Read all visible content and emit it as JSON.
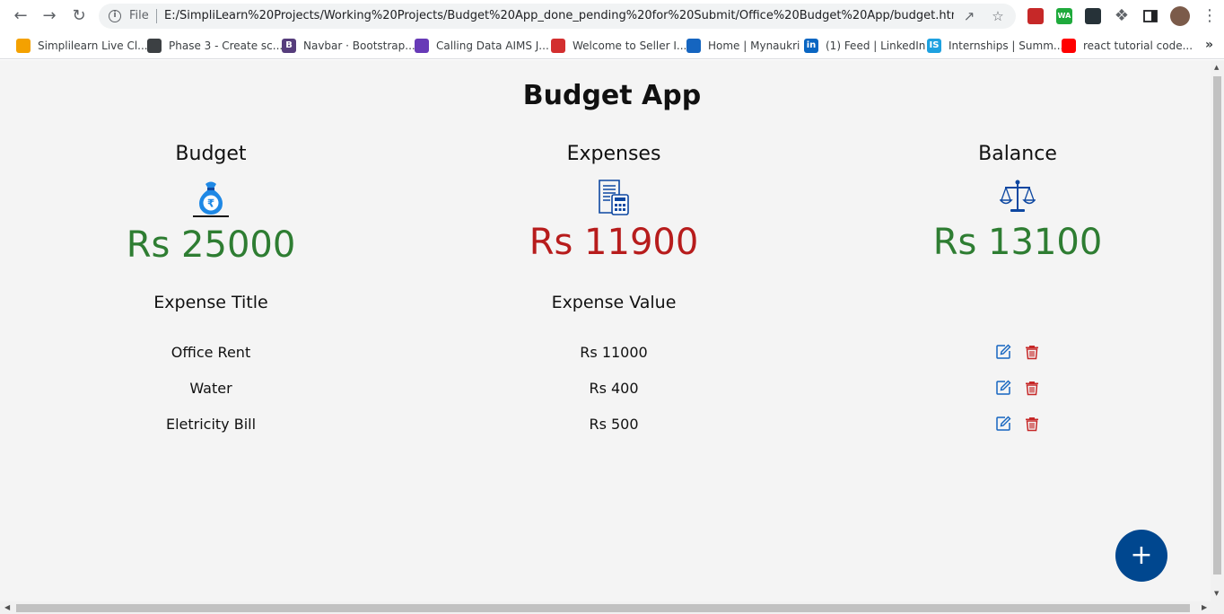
{
  "browser": {
    "scheme_label": "File",
    "url": "E:/SimpliLearn%20Projects/Working%20Projects/Budget%20App_done_pending%20for%20Submit/Office%20Budget%20App/budget.html",
    "extensions": [
      {
        "name": "pdf-extension",
        "label": "",
        "color": "#c62828"
      },
      {
        "name": "whatsapp-extension",
        "label": "WA",
        "color": "#1faa3c"
      },
      {
        "name": "pen-extension",
        "label": "",
        "color": "#263238"
      }
    ]
  },
  "bookmarks": [
    {
      "label": "Simplilearn Live Cl...",
      "icon": "simplilearn-icon",
      "color": "#f4a100"
    },
    {
      "label": "Phase 3 - Create sc...",
      "icon": "globe-icon",
      "color": "#3c4043"
    },
    {
      "label": "Navbar · Bootstrap...",
      "icon": "bootstrap-icon",
      "color": "#563d7c",
      "glyph": "B"
    },
    {
      "label": "Calling Data AIMS J...",
      "icon": "forms-icon",
      "color": "#673ab7"
    },
    {
      "label": "Welcome to Seller I...",
      "icon": "seller-icon",
      "color": "#d32f2f"
    },
    {
      "label": "Home | Mynaukri",
      "icon": "naukri-icon",
      "color": "#1565c0"
    },
    {
      "label": "(1) Feed | LinkedIn",
      "icon": "linkedin-icon",
      "color": "#0a66c2",
      "glyph": "in"
    },
    {
      "label": "Internships | Summ...",
      "icon": "internshala-icon",
      "color": "#1ea1e0",
      "glyph": "IS"
    },
    {
      "label": "react tutorial code...",
      "icon": "youtube-icon",
      "color": "#ff0000"
    }
  ],
  "app": {
    "title": "Budget App",
    "summary": {
      "budget": {
        "label": "Budget",
        "amount": "Rs 25000",
        "icon": "money-bag-icon"
      },
      "expenses": {
        "label": "Expenses",
        "amount": "Rs 11900",
        "icon": "invoice-calculator-icon"
      },
      "balance": {
        "label": "Balance",
        "amount": "Rs 13100",
        "icon": "scales-icon"
      }
    },
    "table": {
      "headers": [
        "Expense Title",
        "Expense Value"
      ],
      "rows": [
        {
          "title": "Office Rent",
          "value": "Rs 11000"
        },
        {
          "title": "Water",
          "value": "Rs 400"
        },
        {
          "title": "Eletricity Bill",
          "value": "Rs 500"
        }
      ]
    },
    "fab_label": "+"
  },
  "colors": {
    "positive": "#2e7d32",
    "negative": "#b71c1c",
    "accent": "#00478f",
    "edit": "#1565c0",
    "delete": "#c62828"
  }
}
